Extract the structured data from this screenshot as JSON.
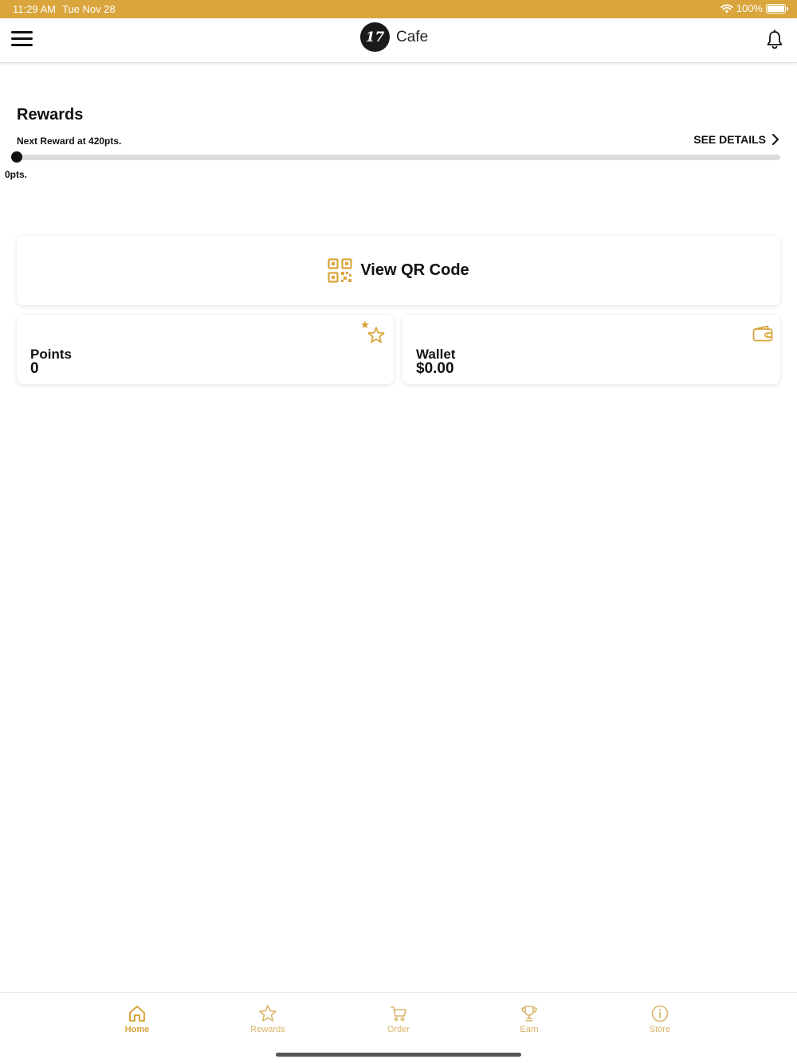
{
  "status_bar": {
    "time": "11:29 AM",
    "date": "Tue Nov 28",
    "battery": "100%"
  },
  "header": {
    "logo_mark": "17",
    "title": "Cafe"
  },
  "rewards": {
    "title": "Rewards",
    "next_reward": "Next Reward at 420pts.",
    "see_details": "SEE DETAILS",
    "progress_label": "0pts.",
    "progress_fraction": 0
  },
  "qr": {
    "label": "View QR Code"
  },
  "points": {
    "label": "Points",
    "value": "0"
  },
  "wallet": {
    "label": "Wallet",
    "value": "$0.00"
  },
  "tabs": [
    {
      "label": "Home",
      "icon": "home-icon",
      "active": true
    },
    {
      "label": "Rewards",
      "icon": "star-icon",
      "active": false
    },
    {
      "label": "Order",
      "icon": "cart-icon",
      "active": false
    },
    {
      "label": "Earn",
      "icon": "trophy-icon",
      "active": false
    },
    {
      "label": "Store",
      "icon": "info-icon",
      "active": false
    }
  ],
  "colors": {
    "accent": "#d9a53c",
    "accent_light": "#d9b46a",
    "text": "#111111",
    "track": "#dcdcdc"
  }
}
